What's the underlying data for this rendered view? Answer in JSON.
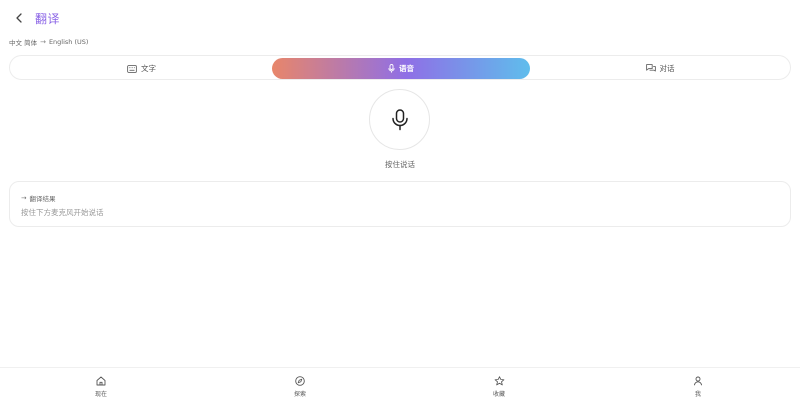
{
  "header": {
    "title": "翻译",
    "back_icon": "chevron-left-icon"
  },
  "language": {
    "source": "中文 简体",
    "arrow": "→",
    "target": "English (US)"
  },
  "tabs": [
    {
      "label": "文字",
      "icon": "keyboard-icon",
      "active": false
    },
    {
      "label": "语音",
      "icon": "microphone-icon",
      "active": true
    },
    {
      "label": "对话",
      "icon": "chat-bubbles-icon",
      "active": false
    }
  ],
  "mic": {
    "icon": "microphone-icon",
    "hint": "按住说话"
  },
  "result": {
    "arrow": "→",
    "title": "翻译结果",
    "placeholder": "按住下方麦克风开始说话"
  },
  "bottom_nav": [
    {
      "label": "现在",
      "icon": "home-icon"
    },
    {
      "label": "探索",
      "icon": "compass-icon"
    },
    {
      "label": "收藏",
      "icon": "star-icon"
    },
    {
      "label": "我",
      "icon": "person-icon"
    }
  ],
  "colors": {
    "title": "#8a63e6",
    "gradient_start": "#e8866a",
    "gradient_mid": "#8f6fe6",
    "gradient_end": "#5fbdec"
  }
}
